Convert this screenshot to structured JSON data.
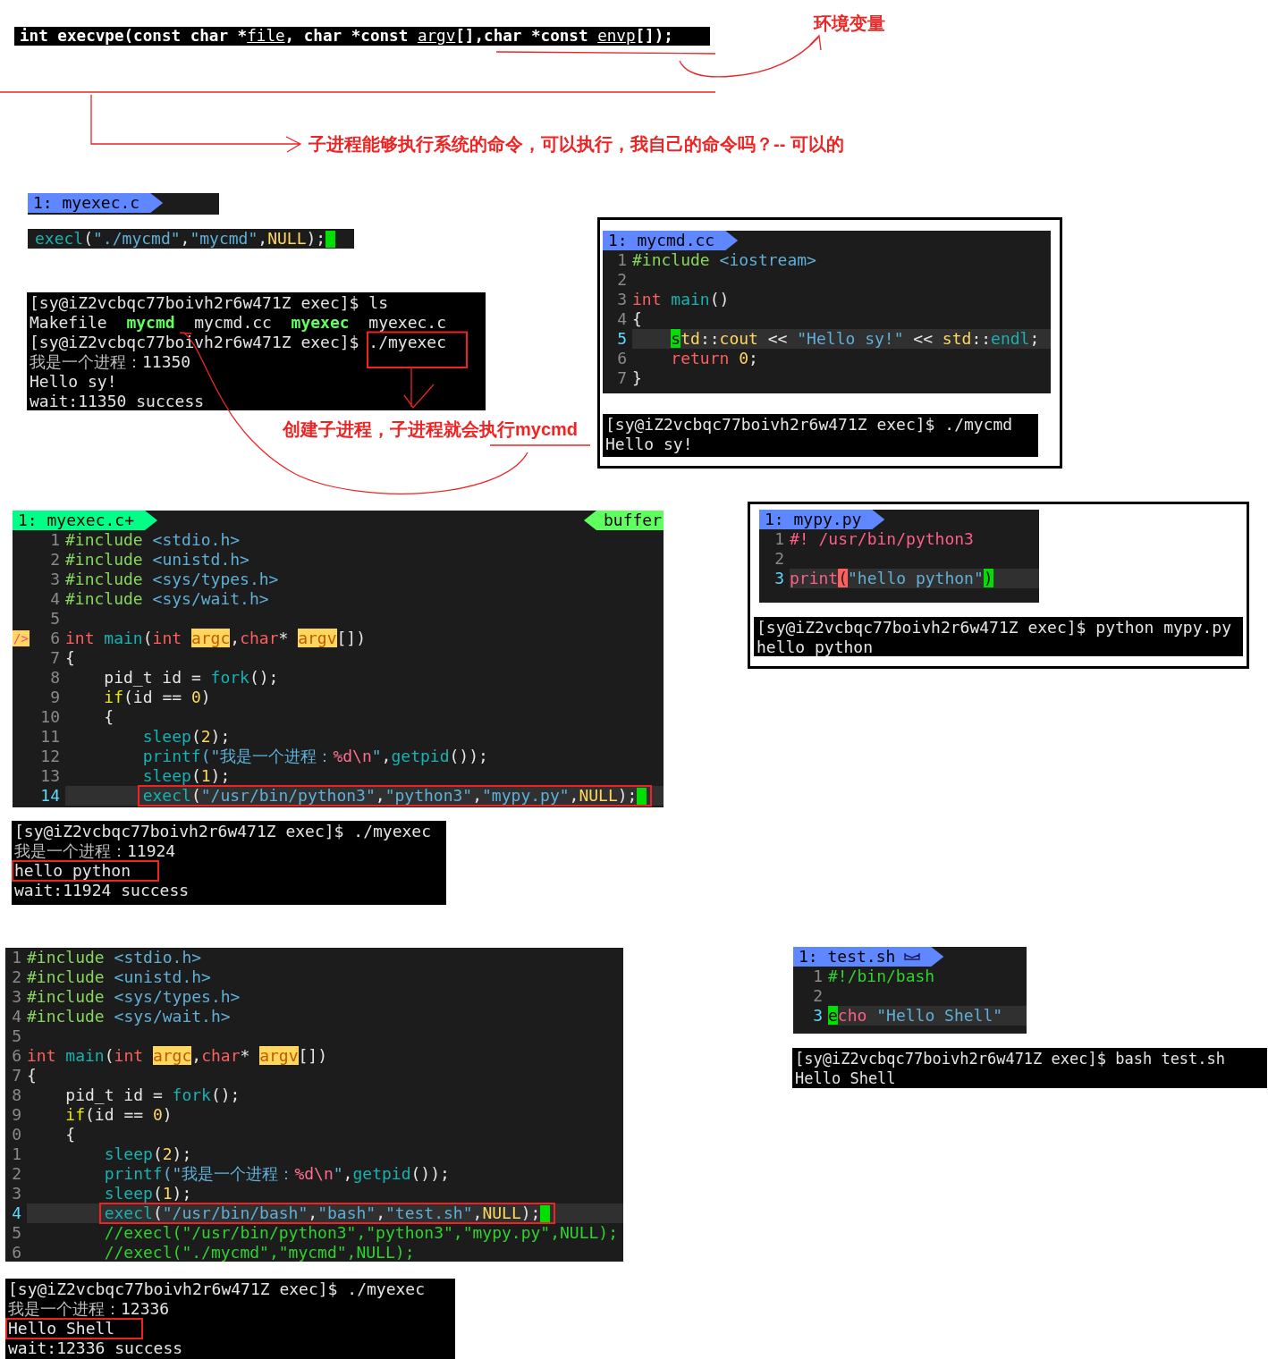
{
  "signature": {
    "segments": [
      {
        "text": "int execvpe(const char *",
        "underline": false
      },
      {
        "text": "file",
        "underline": true
      },
      {
        "text": ", char *const ",
        "underline": false
      },
      {
        "text": "argv",
        "underline": true
      },
      {
        "text": "[],char *const ",
        "underline": false
      },
      {
        "text": "envp",
        "underline": true
      },
      {
        "text": "[]);",
        "underline": false
      }
    ]
  },
  "annotations": [
    "环境变量",
    "子进程能够执行系统的命令，可以执行，我自己的命令吗？-- 可以的",
    "创建子进程，子进程就会执行mycmd"
  ],
  "panels": [
    {
      "kind": "editor",
      "tab": {
        "label": "1: myexec.c",
        "color": "#5f87ff",
        "has_icon": false
      }
    },
    {
      "kind": "editor",
      "lines": [
        {
          "current": false,
          "cursor_at_end": true,
          "segments": [
            {
              "text": "execl",
              "kind": "fn"
            },
            {
              "text": "(",
              "kind": "plain"
            },
            {
              "text": "\"./mycmd\"",
              "kind": "str"
            },
            {
              "text": ",",
              "kind": "plain"
            },
            {
              "text": "\"mycmd\"",
              "kind": "str"
            },
            {
              "text": ",",
              "kind": "plain"
            },
            {
              "text": "NULL",
              "kind": "num"
            },
            {
              "text": ");",
              "kind": "plain"
            }
          ]
        }
      ]
    },
    {
      "kind": "terminal",
      "lines": [
        {
          "segments": [
            {
              "text": "[sy@iZ2vcbqc77boivh2r6w471Z exec]$ ls",
              "kind": "plain"
            }
          ]
        },
        {
          "segments": [
            {
              "text": "Makefile  ",
              "kind": "plain"
            },
            {
              "text": "mycmd",
              "kind": "exe"
            },
            {
              "text": "  mycmd.cc  ",
              "kind": "plain"
            },
            {
              "text": "myexec",
              "kind": "exe"
            },
            {
              "text": "  myexec.c",
              "kind": "plain"
            }
          ]
        },
        {
          "segments": [
            {
              "text": "[sy@iZ2vcbqc77boivh2r6w471Z exec]$ ./myexec",
              "kind": "plain"
            }
          ]
        },
        {
          "segments": [
            {
              "text": "我是一个进程：",
              "kind": "dim"
            },
            {
              "text": "11350",
              "kind": "plain"
            }
          ]
        },
        {
          "segments": [
            {
              "text": "Hello sy!",
              "kind": "plain"
            }
          ]
        },
        {
          "segments": [
            {
              "text": "wait:11350 success",
              "kind": "plain"
            }
          ]
        }
      ]
    },
    {
      "kind": "editor",
      "tab": {
        "label": "1: mycmd.cc",
        "color": "#5f87ff",
        "has_icon": false
      },
      "lines": [
        {
          "number": "1",
          "current": false,
          "indented": false,
          "nested": false,
          "segments": [
            {
              "text": "#include",
              "kind": "pre"
            },
            {
              "text": " <iostream>",
              "kind": "str"
            }
          ]
        },
        {
          "number": "2",
          "current": false
        },
        {
          "number": "3",
          "current": false,
          "indented": false,
          "nested": false,
          "segments": [
            {
              "text": "int ",
              "kind": "kw"
            },
            {
              "text": "main",
              "kind": "fn"
            },
            {
              "text": "()",
              "kind": "plain"
            }
          ]
        },
        {
          "number": "4",
          "current": false,
          "indented": false,
          "nested": false,
          "segments": [
            {
              "text": "{",
              "kind": "plain"
            }
          ]
        },
        {
          "number": "5",
          "current": true,
          "indented": true,
          "nested": false,
          "segments": [
            {
              "text": "s",
              "kind": "cursor"
            },
            {
              "text": "td",
              "kind": "ns"
            },
            {
              "text": "::",
              "kind": "plain"
            },
            {
              "text": "cout",
              "kind": "ns"
            },
            {
              "text": " << ",
              "kind": "plain"
            },
            {
              "text": "\"Hello sy!\"",
              "kind": "str"
            },
            {
              "text": " << ",
              "kind": "plain"
            },
            {
              "text": "std",
              "kind": "ns"
            },
            {
              "text": "::",
              "kind": "plain"
            },
            {
              "text": "endl",
              "kind": "fn"
            },
            {
              "text": ";",
              "kind": "plain"
            }
          ]
        },
        {
          "number": "6",
          "current": false,
          "indented": true,
          "nested": false,
          "segments": [
            {
              "text": "return ",
              "kind": "kw"
            },
            {
              "text": "0",
              "kind": "num"
            },
            {
              "text": ";",
              "kind": "plain"
            }
          ]
        },
        {
          "number": "7",
          "current": false,
          "indented": false,
          "nested": false,
          "segments": [
            {
              "text": "}",
              "kind": "plain"
            }
          ]
        }
      ]
    },
    {
      "kind": "terminal",
      "lines": [
        {
          "segments": [
            {
              "text": "[sy@iZ2vcbqc77boivh2r6w471Z exec]$ ./mycmd",
              "kind": "plain"
            }
          ]
        },
        {
          "segments": [
            {
              "text": "Hello sy!",
              "kind": "plain"
            }
          ]
        }
      ]
    },
    {
      "kind": "editor",
      "tab": {
        "label": "1: myexec.c+",
        "color": "#00ff87",
        "has_icon": false
      },
      "right_tab": {
        "label": "buffer",
        "color": "#5fff5f"
      },
      "lines": [
        {
          "number": "1",
          "current": false,
          "indented": false,
          "nested": false,
          "segments": [
            {
              "text": "#include",
              "kind": "pre"
            },
            {
              "text": " <stdio.h>",
              "kind": "str"
            }
          ]
        },
        {
          "number": "2",
          "current": false,
          "indented": false,
          "nested": false,
          "segments": [
            {
              "text": "#include",
              "kind": "pre"
            },
            {
              "text": " <unistd.h>",
              "kind": "str"
            }
          ]
        },
        {
          "number": "3",
          "current": false,
          "indented": false,
          "nested": false,
          "segments": [
            {
              "text": "#include",
              "kind": "pre"
            },
            {
              "text": " <sys/types.h>",
              "kind": "str"
            }
          ]
        },
        {
          "number": "4",
          "current": false,
          "indented": false,
          "nested": false,
          "segments": [
            {
              "text": "#include",
              "kind": "pre"
            },
            {
              "text": " <sys/wait.h>",
              "kind": "str"
            }
          ]
        },
        {
          "number": "5",
          "current": false
        },
        {
          "number": "6",
          "current": false,
          "indented": false,
          "nested": false,
          "sign": "/>",
          "segments": [
            {
              "text": "int ",
              "kind": "kw"
            },
            {
              "text": "main",
              "kind": "fn"
            },
            {
              "text": "(",
              "kind": "plain"
            },
            {
              "text": "int ",
              "kind": "kw"
            },
            {
              "text": "argc",
              "kind": "hl"
            },
            {
              "text": ",",
              "kind": "plain"
            },
            {
              "text": "char",
              "kind": "kw"
            },
            {
              "text": "* ",
              "kind": "plain"
            },
            {
              "text": "argv",
              "kind": "hl"
            },
            {
              "text": "[])",
              "kind": "plain"
            }
          ]
        },
        {
          "number": "7",
          "current": false,
          "indented": false,
          "nested": false,
          "segments": [
            {
              "text": "{",
              "kind": "plain"
            }
          ]
        },
        {
          "number": "8",
          "current": false,
          "indented": true,
          "nested": false,
          "segments": [
            {
              "text": "pid_t id = ",
              "kind": "plain"
            },
            {
              "text": "fork",
              "kind": "fn"
            },
            {
              "text": "();",
              "kind": "plain"
            }
          ]
        },
        {
          "number": "9",
          "current": false,
          "indented": true,
          "nested": false,
          "segments": [
            {
              "text": "if",
              "kind": "cond"
            },
            {
              "text": "(id == ",
              "kind": "plain"
            },
            {
              "text": "0",
              "kind": "num"
            },
            {
              "text": ")",
              "kind": "plain"
            }
          ]
        },
        {
          "number": "10",
          "current": false,
          "indented": true,
          "nested": false,
          "segments": [
            {
              "text": "{",
              "kind": "plain"
            }
          ]
        },
        {
          "number": "11",
          "current": false,
          "indented": true,
          "nested": true,
          "segments": [
            {
              "text": "sleep",
              "kind": "fn"
            },
            {
              "text": "(",
              "kind": "plain"
            },
            {
              "text": "2",
              "kind": "num"
            },
            {
              "text": ");",
              "kind": "plain"
            }
          ]
        },
        {
          "number": "12",
          "current": false,
          "indented": true,
          "nested": true,
          "segments": [
            {
              "text": "printf",
              "kind": "fn"
            },
            {
              "text": "(\"我是一个进程：",
              "kind": "str"
            },
            {
              "text": "%d\\n",
              "kind": "fmt"
            },
            {
              "text": "\"",
              "kind": "str"
            },
            {
              "text": ",",
              "kind": "plain"
            },
            {
              "text": "getpid",
              "kind": "fn"
            },
            {
              "text": "());",
              "kind": "plain"
            }
          ]
        },
        {
          "number": "13",
          "current": false,
          "indented": true,
          "nested": true,
          "segments": [
            {
              "text": "sleep",
              "kind": "fn"
            },
            {
              "text": "(",
              "kind": "plain"
            },
            {
              "text": "1",
              "kind": "num"
            },
            {
              "text": ");",
              "kind": "plain"
            }
          ]
        },
        {
          "number": "14",
          "current": true,
          "indented": true,
          "nested": true,
          "boxed": true,
          "cursor_at_end": true,
          "segments": [
            {
              "text": "execl",
              "kind": "fn"
            },
            {
              "text": "(",
              "kind": "plain"
            },
            {
              "text": "\"/usr/bin/python3\"",
              "kind": "str"
            },
            {
              "text": ",",
              "kind": "plain"
            },
            {
              "text": "\"python3\"",
              "kind": "str"
            },
            {
              "text": ",",
              "kind": "plain"
            },
            {
              "text": "\"mypy.py\"",
              "kind": "str"
            },
            {
              "text": ",",
              "kind": "plain"
            },
            {
              "text": "NULL",
              "kind": "num"
            },
            {
              "text": ");",
              "kind": "plain"
            }
          ]
        }
      ]
    },
    {
      "kind": "terminal",
      "lines": [
        {
          "segments": [
            {
              "text": "[sy@iZ2vcbqc77boivh2r6w471Z exec]$ ./myexec",
              "kind": "plain"
            }
          ]
        },
        {
          "segments": [
            {
              "text": "我是一个进程：",
              "kind": "dim"
            },
            {
              "text": "11924",
              "kind": "plain"
            }
          ]
        },
        {
          "boxed": true,
          "segments": [
            {
              "text": "hello python",
              "kind": "plain"
            }
          ]
        },
        {
          "segments": [
            {
              "text": "wait:11924 success",
              "kind": "plain"
            }
          ]
        }
      ]
    },
    {
      "kind": "editor",
      "tab": {
        "label": "1: mypy.py",
        "color": "#5f87ff",
        "has_icon": false
      },
      "lines": [
        {
          "number": "1",
          "current": false,
          "segments": [
            {
              "text": "#! /usr/bin/python3",
              "kind": "shebang"
            }
          ]
        },
        {
          "number": "2",
          "current": false
        },
        {
          "number": "3",
          "current": true,
          "segments": [
            {
              "text": "print",
              "kind": "shebang"
            },
            {
              "text": "(",
              "kind": "match"
            },
            {
              "text": "\"hello python\"",
              "kind": "str"
            },
            {
              "text": ")",
              "kind": "cursor"
            }
          ]
        }
      ]
    },
    {
      "kind": "terminal",
      "lines": [
        {
          "segments": [
            {
              "text": "[sy@iZ2vcbqc77boivh2r6w471Z exec]$ python mypy.py",
              "kind": "plain"
            }
          ]
        },
        {
          "segments": [
            {
              "text": "hello python",
              "kind": "plain"
            }
          ]
        }
      ]
    },
    {
      "kind": "editor",
      "lines": [
        {
          "number": "1",
          "current": false,
          "indented": false,
          "nested": false,
          "segments": [
            {
              "text": "#include",
              "kind": "pre"
            },
            {
              "text": " <stdio.h>",
              "kind": "str"
            }
          ]
        },
        {
          "number": "2",
          "current": false,
          "indented": false,
          "nested": false,
          "segments": [
            {
              "text": "#include",
              "kind": "pre"
            },
            {
              "text": " <unistd.h>",
              "kind": "str"
            }
          ]
        },
        {
          "number": "3",
          "current": false,
          "indented": false,
          "nested": false,
          "segments": [
            {
              "text": "#include",
              "kind": "pre"
            },
            {
              "text": " <sys/types.h>",
              "kind": "str"
            }
          ]
        },
        {
          "number": "4",
          "current": false,
          "indented": false,
          "nested": false,
          "segments": [
            {
              "text": "#include",
              "kind": "pre"
            },
            {
              "text": " <sys/wait.h>",
              "kind": "str"
            }
          ]
        },
        {
          "number": "5",
          "current": false
        },
        {
          "number": "6",
          "current": false,
          "indented": false,
          "nested": false,
          "segments": [
            {
              "text": "int ",
              "kind": "kw"
            },
            {
              "text": "main",
              "kind": "fn"
            },
            {
              "text": "(",
              "kind": "plain"
            },
            {
              "text": "int ",
              "kind": "kw"
            },
            {
              "text": "argc",
              "kind": "hl"
            },
            {
              "text": ",",
              "kind": "plain"
            },
            {
              "text": "char",
              "kind": "kw"
            },
            {
              "text": "* ",
              "kind": "plain"
            },
            {
              "text": "argv",
              "kind": "hl"
            },
            {
              "text": "[])",
              "kind": "plain"
            }
          ]
        },
        {
          "number": "7",
          "current": false,
          "indented": false,
          "nested": false,
          "segments": [
            {
              "text": "{",
              "kind": "plain"
            }
          ]
        },
        {
          "number": "8",
          "current": false,
          "indented": true,
          "nested": false,
          "segments": [
            {
              "text": "pid_t id = ",
              "kind": "plain"
            },
            {
              "text": "fork",
              "kind": "fn"
            },
            {
              "text": "();",
              "kind": "plain"
            }
          ]
        },
        {
          "number": "9",
          "current": false,
          "indented": true,
          "nested": false,
          "segments": [
            {
              "text": "if",
              "kind": "cond"
            },
            {
              "text": "(id == ",
              "kind": "plain"
            },
            {
              "text": "0",
              "kind": "num"
            },
            {
              "text": ")",
              "kind": "plain"
            }
          ]
        },
        {
          "number": "0",
          "current": false,
          "indented": true,
          "nested": false,
          "segments": [
            {
              "text": "{",
              "kind": "plain"
            }
          ]
        },
        {
          "number": "1",
          "current": false,
          "indented": true,
          "nested": true,
          "segments": [
            {
              "text": "sleep",
              "kind": "fn"
            },
            {
              "text": "(",
              "kind": "plain"
            },
            {
              "text": "2",
              "kind": "num"
            },
            {
              "text": ");",
              "kind": "plain"
            }
          ]
        },
        {
          "number": "2",
          "current": false,
          "indented": true,
          "nested": true,
          "segments": [
            {
              "text": "printf",
              "kind": "fn"
            },
            {
              "text": "(\"我是一个进程：",
              "kind": "str"
            },
            {
              "text": "%d\\n",
              "kind": "fmt"
            },
            {
              "text": "\"",
              "kind": "str"
            },
            {
              "text": ",",
              "kind": "plain"
            },
            {
              "text": "getpid",
              "kind": "fn"
            },
            {
              "text": "());",
              "kind": "plain"
            }
          ]
        },
        {
          "number": "3",
          "current": false,
          "indented": true,
          "nested": true,
          "segments": [
            {
              "text": "sleep",
              "kind": "fn"
            },
            {
              "text": "(",
              "kind": "plain"
            },
            {
              "text": "1",
              "kind": "num"
            },
            {
              "text": ");",
              "kind": "plain"
            }
          ]
        },
        {
          "number": "4",
          "current": true,
          "indented": true,
          "nested": true,
          "boxed": true,
          "cursor_at_end": true,
          "segments": [
            {
              "text": "execl",
              "kind": "fn"
            },
            {
              "text": "(",
              "kind": "plain"
            },
            {
              "text": "\"/usr/bin/bash\"",
              "kind": "str"
            },
            {
              "text": ",",
              "kind": "plain"
            },
            {
              "text": "\"bash\"",
              "kind": "str"
            },
            {
              "text": ",",
              "kind": "plain"
            },
            {
              "text": "\"test.sh\"",
              "kind": "str"
            },
            {
              "text": ",",
              "kind": "plain"
            },
            {
              "text": "NULL",
              "kind": "num"
            },
            {
              "text": ");",
              "kind": "plain"
            }
          ]
        },
        {
          "number": "5",
          "current": false,
          "indented": true,
          "nested": true,
          "segments": [
            {
              "text": "//execl(\"/usr/bin/python3\",\"python3\",\"mypy.py\",NULL);",
              "kind": "comment"
            }
          ]
        },
        {
          "number": "6",
          "current": false,
          "indented": true,
          "nested": true,
          "segments": [
            {
              "text": "//execl(\"./mycmd\",\"mycmd\",NULL);",
              "kind": "comment"
            }
          ]
        }
      ]
    },
    {
      "kind": "terminal",
      "lines": [
        {
          "segments": [
            {
              "text": "[sy@iZ2vcbqc77boivh2r6w471Z exec]$ ./myexec",
              "kind": "plain"
            }
          ]
        },
        {
          "segments": [
            {
              "text": "我是一个进程：",
              "kind": "dim"
            },
            {
              "text": "12336",
              "kind": "plain"
            }
          ]
        },
        {
          "boxed": true,
          "segments": [
            {
              "text": "Hello Shell",
              "kind": "plain"
            }
          ]
        },
        {
          "segments": [
            {
              "text": "wait:12336 success",
              "kind": "plain"
            }
          ]
        }
      ]
    },
    {
      "kind": "editor",
      "tab": {
        "label": "1: test.sh",
        "color": "#5f87ff",
        "has_icon": true
      },
      "lines": [
        {
          "number": "1",
          "current": false,
          "segments": [
            {
              "text": "#!/bin/bash",
              "kind": "comment"
            }
          ]
        },
        {
          "number": "2",
          "current": false
        },
        {
          "number": "3",
          "current": true,
          "segments": [
            {
              "text": "e",
              "kind": "cursor"
            },
            {
              "text": "cho ",
              "kind": "shebang"
            },
            {
              "text": "\"Hello Shell\"",
              "kind": "str"
            }
          ]
        }
      ]
    },
    {
      "kind": "terminal",
      "lines": [
        {
          "segments": [
            {
              "text": "[sy@iZ2vcbqc77boivh2r6w471Z exec]$ bash test.sh",
              "kind": "plain"
            }
          ]
        },
        {
          "segments": [
            {
              "text": "Hello Shell",
              "kind": "plain"
            }
          ]
        }
      ]
    }
  ]
}
